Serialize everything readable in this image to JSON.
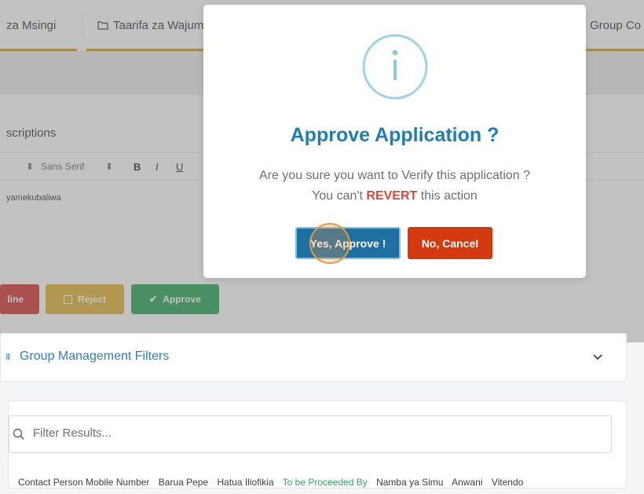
{
  "tabs": [
    {
      "label": "za Msingi"
    },
    {
      "label": "Taarifa za Wajumbe"
    },
    {
      "label": "Group Co"
    }
  ],
  "editor": {
    "label": "scriptions",
    "toolbar": {
      "font": "Sans Serif",
      "bold": "B",
      "italic": "I",
      "underline": "U"
    },
    "content": "yamekubaliwa"
  },
  "actions": {
    "decline_label": "line",
    "reject_label": "Reject",
    "approve_label": "Approve"
  },
  "filters": {
    "title": "Group Management Filters"
  },
  "search": {
    "placeholder": "Filter Results..."
  },
  "columns": [
    {
      "label": "Contact Person Mobile Number"
    },
    {
      "label": "Barua Pepe"
    },
    {
      "label": "Hatua Iliofikia"
    },
    {
      "label": "To be Proceeded By"
    },
    {
      "label": "Namba ya Simu"
    },
    {
      "label": "Anwani"
    },
    {
      "label": "Vitendo"
    }
  ],
  "modal": {
    "title": "Approve Application ?",
    "message_line1": "Are you sure you want to Verify this application ?",
    "message_line2_pre": "You can't",
    "message_line2_emph": "REVERT",
    "message_line2_post": "this action",
    "confirm_label": "Yes, Approve !",
    "cancel_label": "No, Cancel"
  },
  "colors": {
    "title_blue": "#1f7fb4",
    "confirm_btn": "#1e6fa2",
    "cancel_btn": "#d43a0f",
    "revert_red": "#e0453b",
    "approve_green": "#2eaa58",
    "reject_yellow": "#e4b63c",
    "decline_red": "#d63b3b",
    "link_blue": "#2d7fc1"
  }
}
